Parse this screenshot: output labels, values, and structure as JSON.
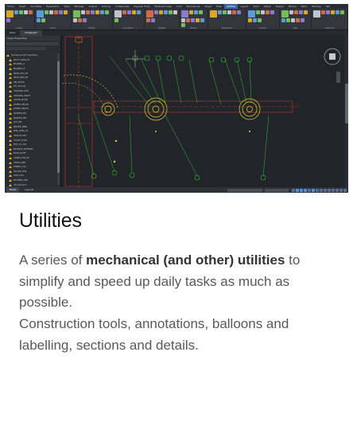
{
  "app": {
    "menu_items": [
      "Home",
      "Insert",
      "Annotate",
      "Parametric",
      "View",
      "Manage",
      "Output",
      "Add-ins",
      "Collaborate",
      "Express Tools",
      "Featured Apps",
      "Civil",
      "Mechanical",
      "Sheet",
      "Help",
      "Utilities",
      "Layout",
      "Tools",
      "Detail",
      "Design",
      "Blocks",
      "Parts",
      "Window",
      "Tab"
    ],
    "active_menu_index": 15,
    "ribbon_groups": [
      "Layers",
      "Draw",
      "Modify",
      "Annotation",
      "Utilities",
      "Blocks",
      "Properties",
      "Groups",
      "View",
      "Clipboard"
    ],
    "doc_tabs": [
      "Start",
      "Drawing1*"
    ],
    "active_doc_tab_index": 1,
    "panel_title": "Layer Properties",
    "tree_items": [
      "Mechanical Part Assembly",
      "SHAFT_MAIN_01",
      "BEARING_A",
      "BEARING_B",
      "GEAR_Z24_M2",
      "GEAR_Z48_M2",
      "PIN_D6x30",
      "KEY_8x7x40",
      "HOUSING_LEFT",
      "HOUSING_RIGHT",
      "COVER_PLATE",
      "SCREW_M6x20",
      "SCREW_M8x25",
      "WASHER_M6",
      "WASHER_M8",
      "NUT_M8",
      "SPACER_RING",
      "SEAL_RING_40",
      "CIRCLIP_D40",
      "PULLEY_D120",
      "BELT_XL_240",
      "BRACKET_SUPPORT",
      "BASE_PLATE",
      "DOWEL_PIN_D8",
      "LEVER_ARM",
      "SPRING_C12",
      "ROLLER_D30",
      "AXLE_D20",
      "BUSHING_D20",
      "COLLAR_D25"
    ],
    "layout_tabs": [
      "Model",
      "Layout1"
    ],
    "active_layout_tab_index": 0
  },
  "text": {
    "title": "Utilities",
    "desc_p1_pre": "A series of ",
    "desc_p1_bold": "mechanical (and other) utilities",
    "desc_p1_post": " to simplify and speed up daily tasks as much as possible.",
    "desc_p2": "Construction tools, annotations, balloons and labelling, sections and details."
  },
  "colors": {
    "accent_blue": "#4f8fd6",
    "cad_green": "#2fbf2a",
    "cad_yellow": "#e6d22a",
    "cad_red": "#c8352a",
    "cad_background": "#212429"
  },
  "icons": [
    "layer-warning-icon",
    "balloon-icon",
    "viewcube-icon",
    "orbit-icon"
  ]
}
